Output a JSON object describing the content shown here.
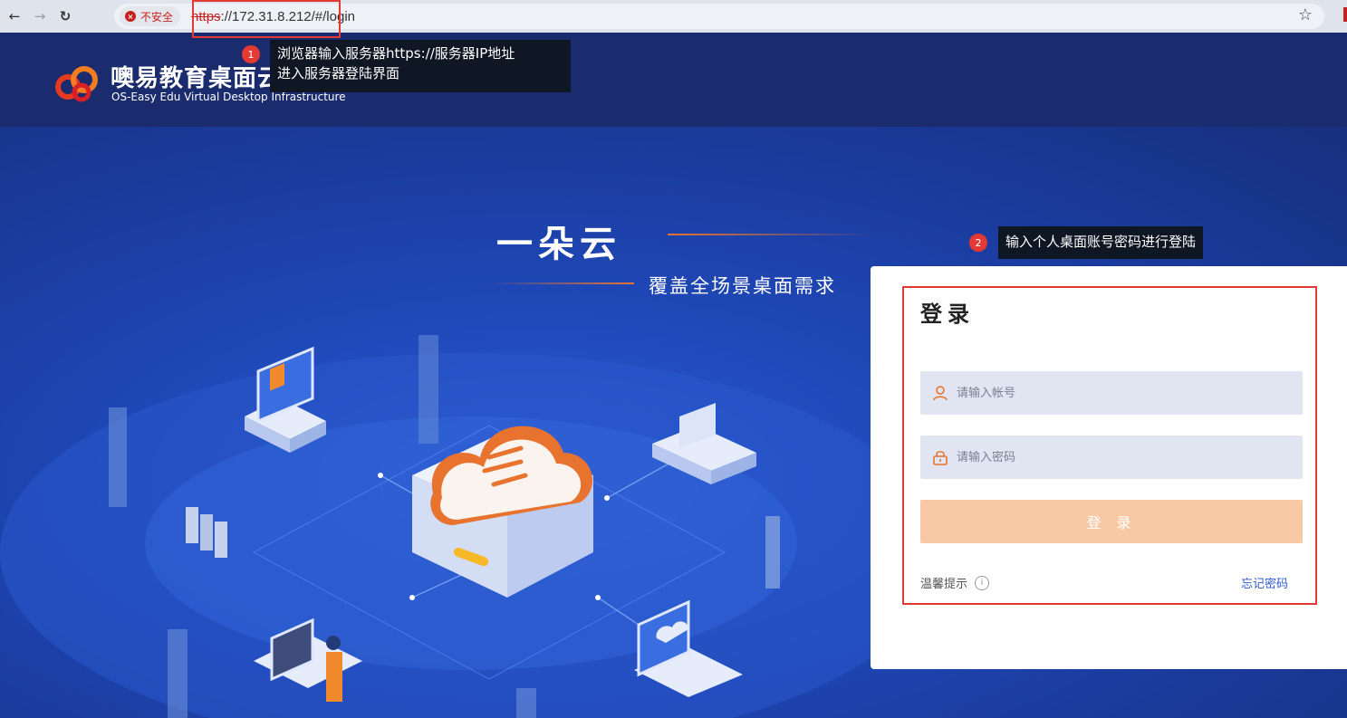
{
  "browser": {
    "security_label": "不安全",
    "url_scheme": "https",
    "url_rest": "://172.31.8.212/#/login"
  },
  "header": {
    "brand_cn": "噢易教育桌面云",
    "brand_en": "OS-Easy Edu Virtual Desktop Infrastructure"
  },
  "hero": {
    "slogan": "一朵云",
    "subtitle": "覆盖全场景桌面需求"
  },
  "login": {
    "title": "登录",
    "username_placeholder": "请输入帐号",
    "password_placeholder": "请输入密码",
    "submit_label": "登 录",
    "tip_label": "温馨提示",
    "forgot_label": "忘记密码"
  },
  "annotations": {
    "step1_number": "1",
    "step1_line1": "浏览器输入服务器https://服务器IP地址",
    "step1_line2": "进入服务器登陆界面",
    "step2_number": "2",
    "step2_text": "输入个人桌面账号密码进行登陆"
  },
  "colors": {
    "accent_orange": "#e8732e",
    "button_disabled": "#f8c9a4",
    "annotation_red": "#e53935",
    "link_blue": "#2f5bd3"
  }
}
